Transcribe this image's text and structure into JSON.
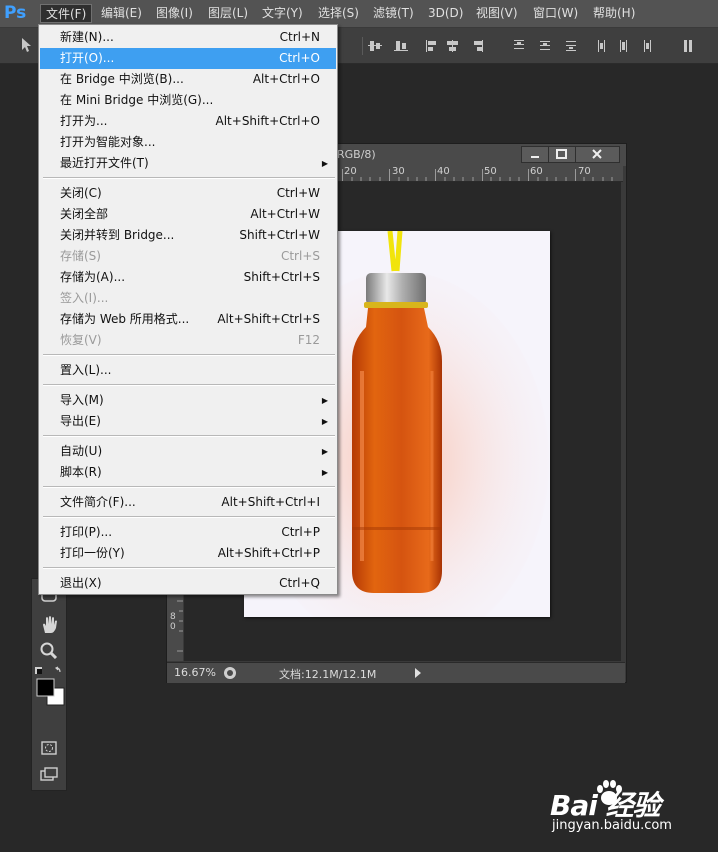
{
  "app": {
    "logo": "Ps"
  },
  "menubar": {
    "items": [
      {
        "label": "文件(F)"
      },
      {
        "label": "编辑(E)"
      },
      {
        "label": "图像(I)"
      },
      {
        "label": "图层(L)"
      },
      {
        "label": "文字(Y)"
      },
      {
        "label": "选择(S)"
      },
      {
        "label": "滤镜(T)"
      },
      {
        "label": "3D(D)"
      },
      {
        "label": "视图(V)"
      },
      {
        "label": "窗口(W)"
      },
      {
        "label": "帮助(H)"
      }
    ]
  },
  "file_menu": {
    "items": [
      {
        "label": "新建(N)...",
        "shortcut": "Ctrl+N"
      },
      {
        "label": "打开(O)...",
        "shortcut": "Ctrl+O"
      },
      {
        "label": "在 Bridge 中浏览(B)...",
        "shortcut": "Alt+Ctrl+O"
      },
      {
        "label": "在 Mini Bridge 中浏览(G)...",
        "shortcut": ""
      },
      {
        "label": "打开为...",
        "shortcut": "Alt+Shift+Ctrl+O"
      },
      {
        "label": "打开为智能对象...",
        "shortcut": ""
      },
      {
        "label": "最近打开文件(T)",
        "shortcut": ""
      },
      {
        "label": "关闭(C)",
        "shortcut": "Ctrl+W"
      },
      {
        "label": "关闭全部",
        "shortcut": "Alt+Ctrl+W"
      },
      {
        "label": "关闭并转到 Bridge...",
        "shortcut": "Shift+Ctrl+W"
      },
      {
        "label": "存储(S)",
        "shortcut": "Ctrl+S"
      },
      {
        "label": "存储为(A)...",
        "shortcut": "Shift+Ctrl+S"
      },
      {
        "label": "签入(I)...",
        "shortcut": ""
      },
      {
        "label": "存储为 Web 所用格式...",
        "shortcut": "Alt+Shift+Ctrl+S"
      },
      {
        "label": "恢复(V)",
        "shortcut": "F12"
      },
      {
        "label": "置入(L)...",
        "shortcut": ""
      },
      {
        "label": "导入(M)",
        "shortcut": ""
      },
      {
        "label": "导出(E)",
        "shortcut": ""
      },
      {
        "label": "自动(U)",
        "shortcut": ""
      },
      {
        "label": "脚本(R)",
        "shortcut": ""
      },
      {
        "label": "文件简介(F)...",
        "shortcut": "Alt+Shift+Ctrl+I"
      },
      {
        "label": "打印(P)...",
        "shortcut": "Ctrl+P"
      },
      {
        "label": "打印一份(Y)",
        "shortcut": "Alt+Shift+Ctrl+P"
      },
      {
        "label": "退出(X)",
        "shortcut": "Ctrl+Q"
      }
    ]
  },
  "document": {
    "title_suffix": "RGB/8)",
    "ruler_labels": [
      "20",
      "30",
      "40",
      "50",
      "60",
      "70"
    ],
    "zoom": "16.67%",
    "doc_size": "文档:12.1M/12.1M"
  },
  "colors": {
    "highlight": "#3e9ff1",
    "menu_bg": "#f0f0f0",
    "workspace": "#282828"
  },
  "watermark": {
    "logo": "Bai 经验",
    "url": "jingyan.baidu.com"
  }
}
